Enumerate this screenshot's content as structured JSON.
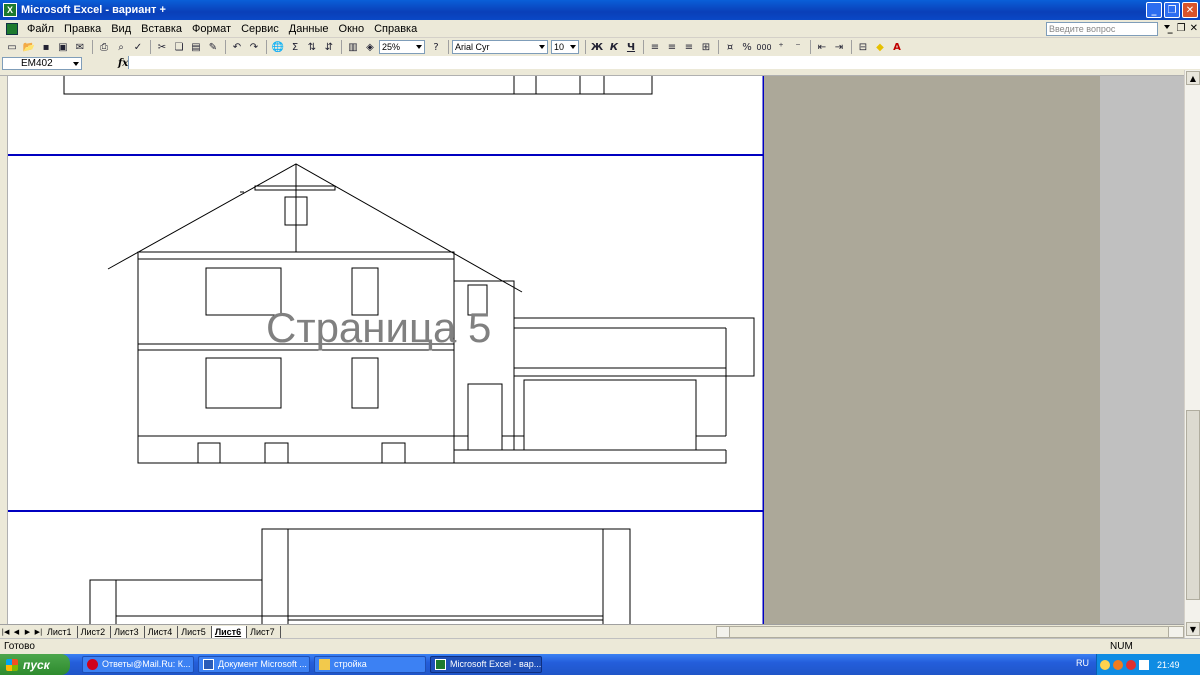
{
  "window": {
    "title": "Microsoft Excel - вариант +",
    "app_icon": "excel-icon"
  },
  "menu": {
    "items": [
      "Файл",
      "Правка",
      "Вид",
      "Вставка",
      "Формат",
      "Сервис",
      "Данные",
      "Окно",
      "Справка"
    ],
    "help_placeholder": "Введите вопрос"
  },
  "toolbar": {
    "zoom": "25%",
    "font_name": "Arial Cyr",
    "font_size": "10",
    "bold_label": "Ж",
    "italic_label": "К",
    "underline_label": "Ч",
    "percent_label": "%",
    "thousands_label": "000"
  },
  "formula_bar": {
    "name_box": "EM402",
    "fx_label": "fx",
    "formula": ""
  },
  "page": {
    "watermark": "Страница 5"
  },
  "sheets": {
    "tabs": [
      "Лист1",
      "Лист2",
      "Лист3",
      "Лист4",
      "Лист5",
      "Лист6",
      "Лист7"
    ],
    "active": "Лист6"
  },
  "status": {
    "left": "Готово",
    "num": "NUM"
  },
  "taskbar": {
    "start_label": "пуск",
    "tasks": [
      {
        "label": "Ответы@Mail.Ru: К...",
        "icon": "opera-icon"
      },
      {
        "label": "Документ Microsoft ...",
        "icon": "word-icon"
      },
      {
        "label": "стройка",
        "icon": "folder-icon"
      },
      {
        "label": "Microsoft Excel - вар...",
        "icon": "excel-icon"
      }
    ],
    "active_task": "Microsoft Excel - вар...",
    "language": "RU",
    "clock": "21:49"
  },
  "colors": {
    "page_break": "#0000c0",
    "title_bar": "#0a5fd8",
    "taskbar": "#245edb",
    "tray": "#0f8ce3",
    "sheet_bg": "#aca899"
  }
}
